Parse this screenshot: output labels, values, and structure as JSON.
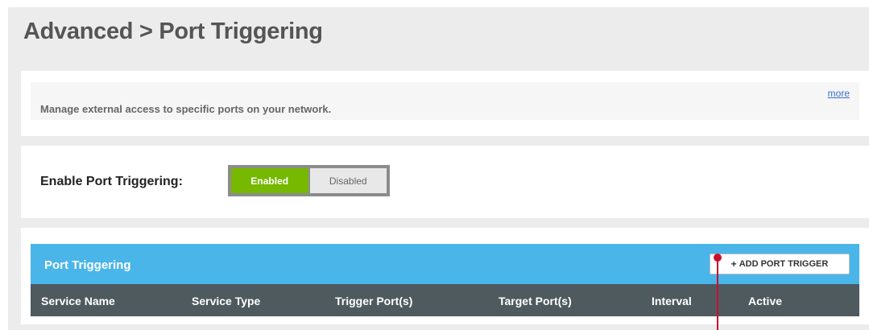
{
  "page": {
    "title": "Advanced > Port Triggering"
  },
  "description": {
    "text": "Manage external access to specific ports on your network.",
    "more_link": "more"
  },
  "enable": {
    "label": "Enable Port Triggering:",
    "options": [
      "Enabled",
      "Disabled"
    ],
    "selected": "Enabled"
  },
  "table": {
    "title": "Port Triggering",
    "add_button": "ADD PORT TRIGGER",
    "add_icon": "plus-icon",
    "columns": [
      "Service Name",
      "Service Type",
      "Trigger Port(s)",
      "Target Port(s)",
      "Interval",
      "Active"
    ]
  },
  "colors": {
    "accent_blue": "#4ab5e8",
    "enabled_green": "#77b800",
    "column_header_bg": "#4f5a5f",
    "callout_red": "#c8102e"
  }
}
